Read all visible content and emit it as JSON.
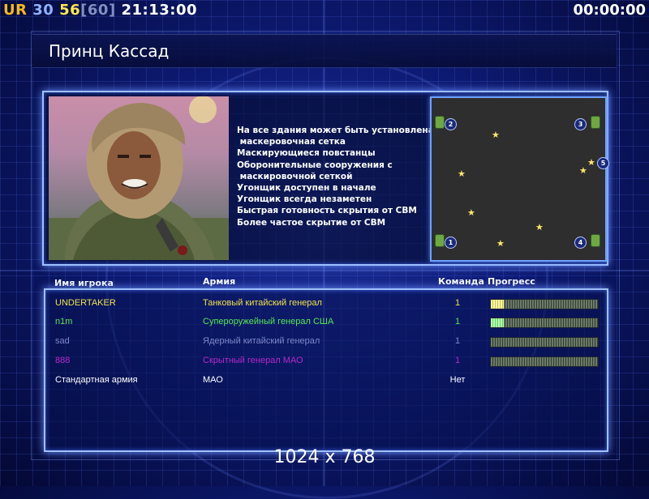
{
  "status": {
    "faction_tag": "UR",
    "value_a": "30",
    "value_b": "56",
    "value_c": "[60]",
    "clock": "21:13:00",
    "timer": "00:00:00"
  },
  "general": {
    "name": "Принц Кассад",
    "description": [
      "На все здания может быть установлена",
      " маскеровочная сетка",
      "Маскирующиеся повстанцы",
      "Оборонительные сооружения с",
      " маскировочной сеткой",
      "Угонщик доступен в начале",
      "Угонщик всегда незаметен",
      "Быстрая готовность скрытия от СВМ",
      "Более частое скрытие от СВМ"
    ]
  },
  "map": {
    "positions": [
      "1",
      "2",
      "3",
      "4",
      "5"
    ]
  },
  "table": {
    "headers": {
      "name": "Имя игрока",
      "army": "Армия",
      "team": "Команда",
      "progress": "Прогресс"
    },
    "rows": [
      {
        "name": "UNDERTAKER",
        "army": "Танковый китайский генерал",
        "team": "1",
        "progress": 0.12
      },
      {
        "name": "n1m",
        "army": "Супероружейный генерал США",
        "team": "1",
        "progress": 0.12
      },
      {
        "name": "sad",
        "army": "Ядерный китайский генерал",
        "team": "1",
        "progress": 0
      },
      {
        "name": "888",
        "army": "Скрытный генерал МАО",
        "team": "1",
        "progress": 0
      },
      {
        "name": "Стандартная армия",
        "army": "МАО",
        "team": "Нет"
      }
    ]
  },
  "resolution": "1024 x 768",
  "colors": {
    "background": "#0d1a73",
    "frame_glow": "#9fc0ff",
    "player1": "#f0e24c",
    "player2": "#55e855",
    "player3": "#8088c8",
    "player4": "#b828c8"
  }
}
